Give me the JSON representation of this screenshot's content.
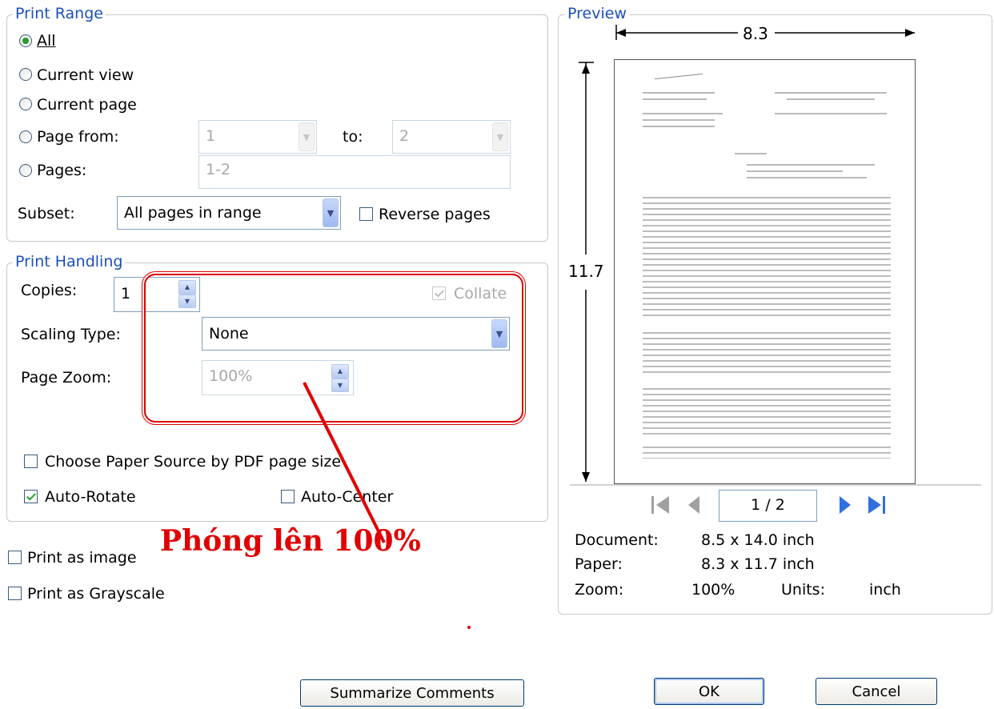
{
  "print_range": {
    "legend": "Print Range",
    "all": "All",
    "current_view": "Current view",
    "current_page": "Current page",
    "page_from": "Page from:",
    "page_from_value": "1",
    "to_label": "to:",
    "page_to_value": "2",
    "pages": "Pages:",
    "pages_value": "1-2",
    "subset": "Subset:",
    "subset_value": "All pages in range",
    "reverse_pages": "Reverse pages"
  },
  "print_handling": {
    "legend": "Print Handling",
    "copies": "Copies:",
    "copies_value": "1",
    "collate": "Collate",
    "scaling_type": "Scaling Type:",
    "scaling_value": "None",
    "page_zoom": "Page Zoom:",
    "page_zoom_value": "100%",
    "choose_paper": "Choose Paper Source by PDF page size",
    "auto_rotate": "Auto-Rotate",
    "auto_center": "Auto-Center"
  },
  "print_as_image": "Print as image",
  "print_as_grayscale": "Print as Grayscale",
  "annotation": {
    "text": "Phóng lên 100%",
    "color": "#e00000"
  },
  "preview": {
    "legend": "Preview",
    "width": "8.3",
    "height": "11.7",
    "page_indicator": "1 / 2",
    "document_label": "Document:",
    "document_value": "8.5 x 14.0 inch",
    "paper_label": "Paper:",
    "paper_value": "8.3 x 11.7 inch",
    "zoom_label": "Zoom:",
    "zoom_value": "100%",
    "units_label": "Units:",
    "units_value": "inch"
  },
  "buttons": {
    "summarize": "Summarize Comments",
    "ok": "OK",
    "cancel": "Cancel"
  },
  "icons": [
    "first-page-icon",
    "prev-page-icon",
    "next-page-icon",
    "last-page-icon",
    "dropdown-arrow-icon",
    "spinner-icon"
  ]
}
